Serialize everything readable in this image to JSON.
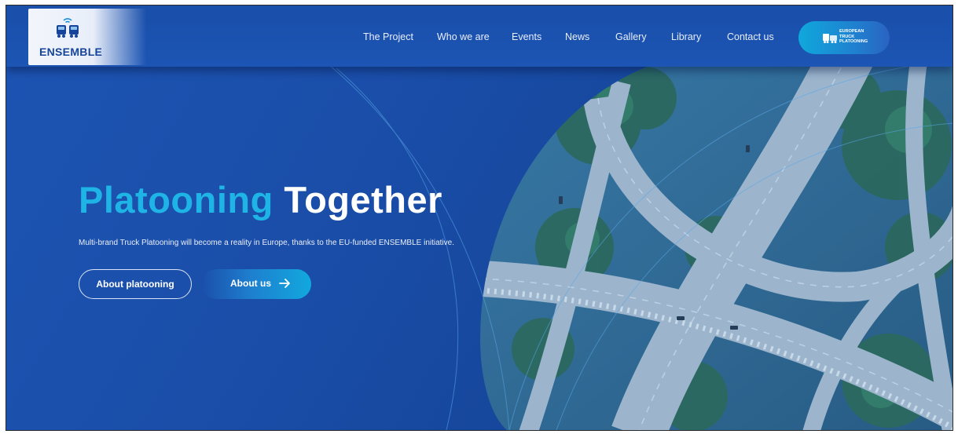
{
  "brand": {
    "name": "ENSEMBLE"
  },
  "nav": {
    "items": [
      "The Project",
      "Who we are",
      "Events",
      "News",
      "Gallery",
      "Library",
      "Contact us"
    ],
    "partner_button": {
      "lines": [
        "EUROPEAN",
        "TRUCK",
        "PLATOONING"
      ]
    }
  },
  "hero": {
    "headline_highlight": "Platooning",
    "headline_rest": "Together",
    "subtext": "Multi-brand Truck Platooning will become a reality in Europe, thanks to the EU-funded ENSEMBLE initiative.",
    "primary_button": "About platooning",
    "secondary_button": "About us"
  },
  "colors": {
    "background": "#1a4ea9",
    "accent": "#1fb4e6",
    "text": "#ffffff"
  },
  "icons": {
    "logo": "trucks-wifi-icon",
    "partner": "truck-platoon-icon",
    "arrow": "arrow-right-icon"
  }
}
